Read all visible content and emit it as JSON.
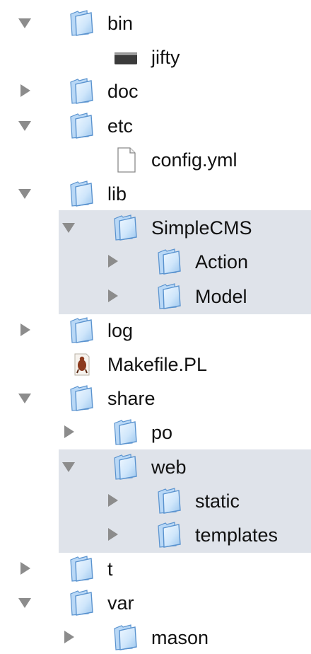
{
  "tree": [
    {
      "label": "bin",
      "type": "folder",
      "depth": 0,
      "state": "expanded",
      "selected_group": false
    },
    {
      "label": "jifty",
      "type": "executable",
      "depth": 1,
      "state": "none",
      "selected_group": false
    },
    {
      "label": "doc",
      "type": "folder",
      "depth": 0,
      "state": "collapsed",
      "selected_group": false
    },
    {
      "label": "etc",
      "type": "folder",
      "depth": 0,
      "state": "expanded",
      "selected_group": false
    },
    {
      "label": "config.yml",
      "type": "document",
      "depth": 1,
      "state": "none",
      "selected_group": false
    },
    {
      "label": "lib",
      "type": "folder",
      "depth": 0,
      "state": "expanded",
      "selected_group": false
    },
    {
      "label": "SimpleCMS",
      "type": "folder",
      "depth": 1,
      "state": "expanded",
      "selected_group": true
    },
    {
      "label": "Action",
      "type": "folder",
      "depth": 2,
      "state": "collapsed",
      "selected_group": true
    },
    {
      "label": "Model",
      "type": "folder",
      "depth": 2,
      "state": "collapsed",
      "selected_group": true
    },
    {
      "label": "log",
      "type": "folder",
      "depth": 0,
      "state": "collapsed",
      "selected_group": false
    },
    {
      "label": "Makefile.PL",
      "type": "perl-script",
      "depth": 0,
      "state": "none",
      "selected_group": false
    },
    {
      "label": "share",
      "type": "folder",
      "depth": 0,
      "state": "expanded",
      "selected_group": false
    },
    {
      "label": "po",
      "type": "folder",
      "depth": 1,
      "state": "collapsed",
      "selected_group": false
    },
    {
      "label": "web",
      "type": "folder",
      "depth": 1,
      "state": "expanded",
      "selected_group": true
    },
    {
      "label": "static",
      "type": "folder",
      "depth": 2,
      "state": "collapsed",
      "selected_group": true
    },
    {
      "label": "templates",
      "type": "folder",
      "depth": 2,
      "state": "collapsed",
      "selected_group": true
    },
    {
      "label": "t",
      "type": "folder",
      "depth": 0,
      "state": "collapsed",
      "selected_group": false
    },
    {
      "label": "var",
      "type": "folder",
      "depth": 0,
      "state": "expanded",
      "selected_group": false
    },
    {
      "label": "mason",
      "type": "folder",
      "depth": 1,
      "state": "collapsed",
      "selected_group": false
    }
  ],
  "colors": {
    "selection_background": "#dfe3ea",
    "disclosure_arrow": "#8c8c8c",
    "folder_light": "#cfe6fb",
    "folder_dark": "#5a93cf",
    "text": "#111111"
  },
  "icons": {
    "folder": "folder-icon",
    "executable": "terminal-executable-icon",
    "document": "document-icon",
    "perl-script": "perl-script-icon",
    "expanded": "disclosure-triangle-down-icon",
    "collapsed": "disclosure-triangle-right-icon"
  }
}
